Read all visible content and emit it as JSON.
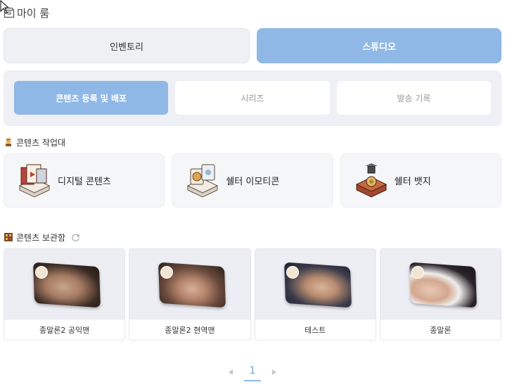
{
  "page": {
    "title": "마이 룸"
  },
  "top_tabs": [
    {
      "label": "인벤토리",
      "active": false
    },
    {
      "label": "스튜디오",
      "active": true
    }
  ],
  "sub_tabs": [
    {
      "label": "콘텐츠 등록 및 배포",
      "active": true
    },
    {
      "label": "시리즈",
      "active": false
    },
    {
      "label": "발송 기록",
      "active": false
    }
  ],
  "workbench": {
    "heading": "콘텐츠 작업대",
    "items": [
      {
        "label": "디지털 콘텐츠",
        "icon": "digital-content-icon"
      },
      {
        "label": "쉘터 이모티콘",
        "icon": "emoticon-icon"
      },
      {
        "label": "쉘터 뱃지",
        "icon": "badge-icon"
      }
    ]
  },
  "storage": {
    "heading": "콘텐츠 보관함",
    "items": [
      {
        "caption": "종말론2 공익맨"
      },
      {
        "caption": "종말론2 현역맨"
      },
      {
        "caption": "테스트"
      },
      {
        "caption": "종말론"
      }
    ]
  },
  "pagination": {
    "current": "1"
  },
  "colors": {
    "accent": "#8fb8e6",
    "panel": "#eef0f5"
  }
}
